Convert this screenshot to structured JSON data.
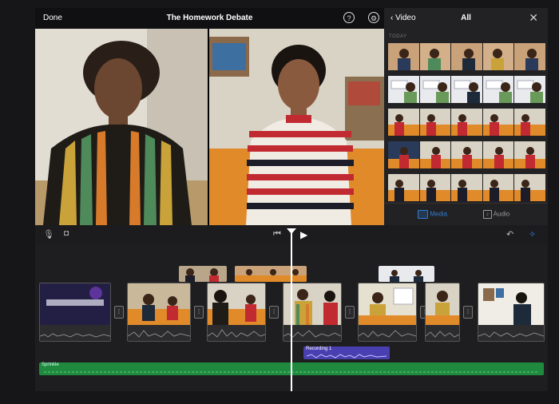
{
  "header": {
    "done_label": "Done",
    "project_title": "The Homework Debate"
  },
  "browser": {
    "back_label": "Video",
    "category_label": "All",
    "section_label": "TODAY",
    "tabs": [
      {
        "label": "Media",
        "active": true
      },
      {
        "label": "Audio",
        "active": false
      }
    ]
  },
  "timeline": {
    "recording_label": "Recording 1",
    "music_label": "Sprinkle"
  },
  "colors": {
    "accent": "#2e7dd7",
    "recording": "#4a3fb0",
    "music": "#1f8a3e"
  }
}
